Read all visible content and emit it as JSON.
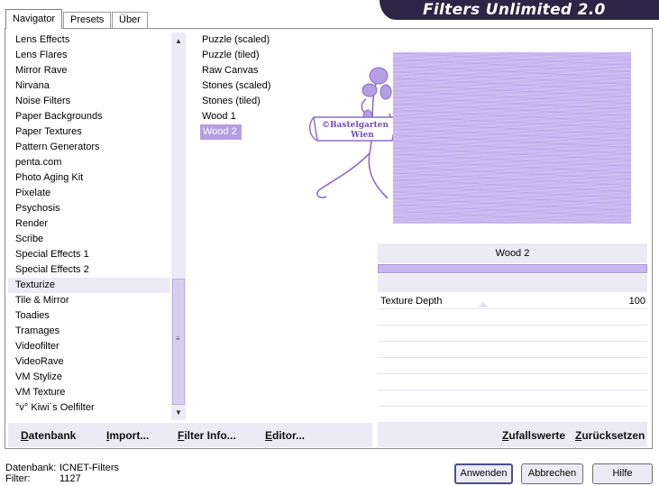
{
  "tabs": [
    {
      "label": "Navigator",
      "active": true
    },
    {
      "label": "Presets",
      "active": false
    },
    {
      "label": "Über",
      "active": false
    }
  ],
  "banner_title": "Filters Unlimited 2.0",
  "categories": [
    "Lens Effects",
    "Lens Flares",
    "Mirror Rave",
    "Nirvana",
    "Noise Filters",
    "Paper Backgrounds",
    "Paper Textures",
    "Pattern Generators",
    "penta.com",
    "Photo Aging Kit",
    "Pixelate",
    "Psychosis",
    "Render",
    "Scribe",
    "Special Effects 1",
    "Special Effects 2",
    "Texturize",
    "Tile & Mirror",
    "Toadies",
    "Tramages",
    "Videofilter",
    "VideoRave",
    "VM Stylize",
    "VM Texture",
    "°v° Kiwi`s Oelfilter"
  ],
  "selected_category": "Texturize",
  "filters": [
    "Puzzle (scaled)",
    "Puzzle (tiled)",
    "Raw Canvas",
    "Stones (scaled)",
    "Stones (tiled)",
    "Wood 1",
    "Wood 2"
  ],
  "selected_filter": "Wood 2",
  "watermark": {
    "line1": "©Bastelgarten",
    "line2": "Wien"
  },
  "params": {
    "title": "Wood 2",
    "rows": [
      {
        "label": "Texture Depth",
        "value": "100"
      }
    ]
  },
  "lower_left_buttons": [
    {
      "key": "D",
      "rest": "atenbank"
    },
    {
      "key": "I",
      "rest": "mport..."
    },
    {
      "key": "F",
      "rest": "ilter Info..."
    },
    {
      "key": "E",
      "rest": "ditor..."
    }
  ],
  "lower_right_buttons": [
    {
      "key": "Z",
      "rest": "ufallswerte"
    },
    {
      "key": "Z",
      "rest": "urücksetzen"
    }
  ],
  "footer": {
    "db_label": "Datenbank:",
    "db_value": "ICNET-Filters",
    "filter_label": "Filter:",
    "filter_value": "1127"
  },
  "buttons": {
    "apply": "Anwenden",
    "cancel": "Abbrechen",
    "help": "Hilfe"
  },
  "colors": {
    "accent": "#b49fe2",
    "panel": "#ecebf5",
    "banner": "#2c2545",
    "preview": "#c9b6ef"
  }
}
